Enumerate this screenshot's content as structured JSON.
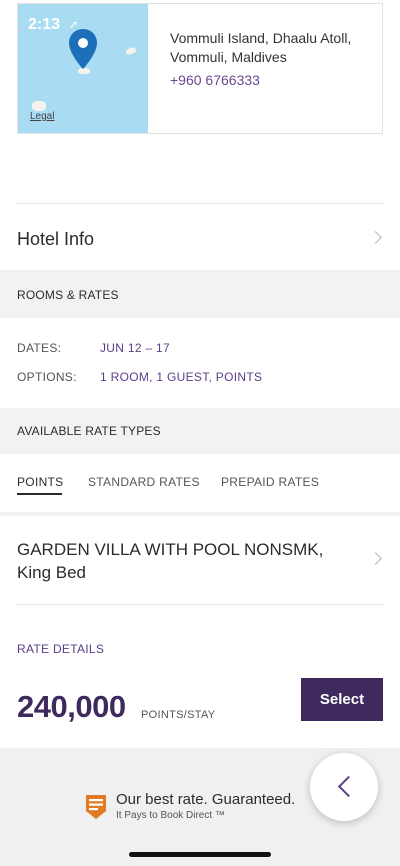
{
  "map": {
    "time": "2:13",
    "legal_label": "Legal"
  },
  "hotel": {
    "address": "Vommuli Island, Dhaalu Atoll, Vommuli, Maldives",
    "phone": "+960 6766333",
    "info_label": "Hotel Info"
  },
  "rooms_rates": {
    "header": "ROOMS & RATES",
    "dates_label": "DATES:",
    "dates_value": "JUN 12 – 17",
    "options_label": "OPTIONS:",
    "options_value": "1 ROOM, 1 GUEST, POINTS"
  },
  "rate_types": {
    "header": "AVAILABLE RATE TYPES",
    "tabs": [
      {
        "label": "POINTS",
        "active": true
      },
      {
        "label": "STANDARD RATES",
        "active": false
      },
      {
        "label": "PREPAID RATES",
        "active": false
      }
    ]
  },
  "room": {
    "name": "GARDEN VILLA WITH POOL NONSMK, King Bed",
    "rate_details_label": "RATE DETAILS",
    "points": "240,000",
    "points_unit": "POINTS/STAY",
    "select_label": "Select"
  },
  "footer": {
    "best_rate": "Our best rate. Guaranteed.",
    "tagline": "It Pays to Book Direct ™"
  },
  "colors": {
    "brand_purple": "#3f2a5e",
    "accent_purple": "#5b3e87",
    "map_water": "#a9dcf2",
    "badge_orange": "#e07b24"
  },
  "icons": [
    "location-pin-icon",
    "chevron-right-icon",
    "back-chevron-icon",
    "best-rate-badge-icon"
  ]
}
